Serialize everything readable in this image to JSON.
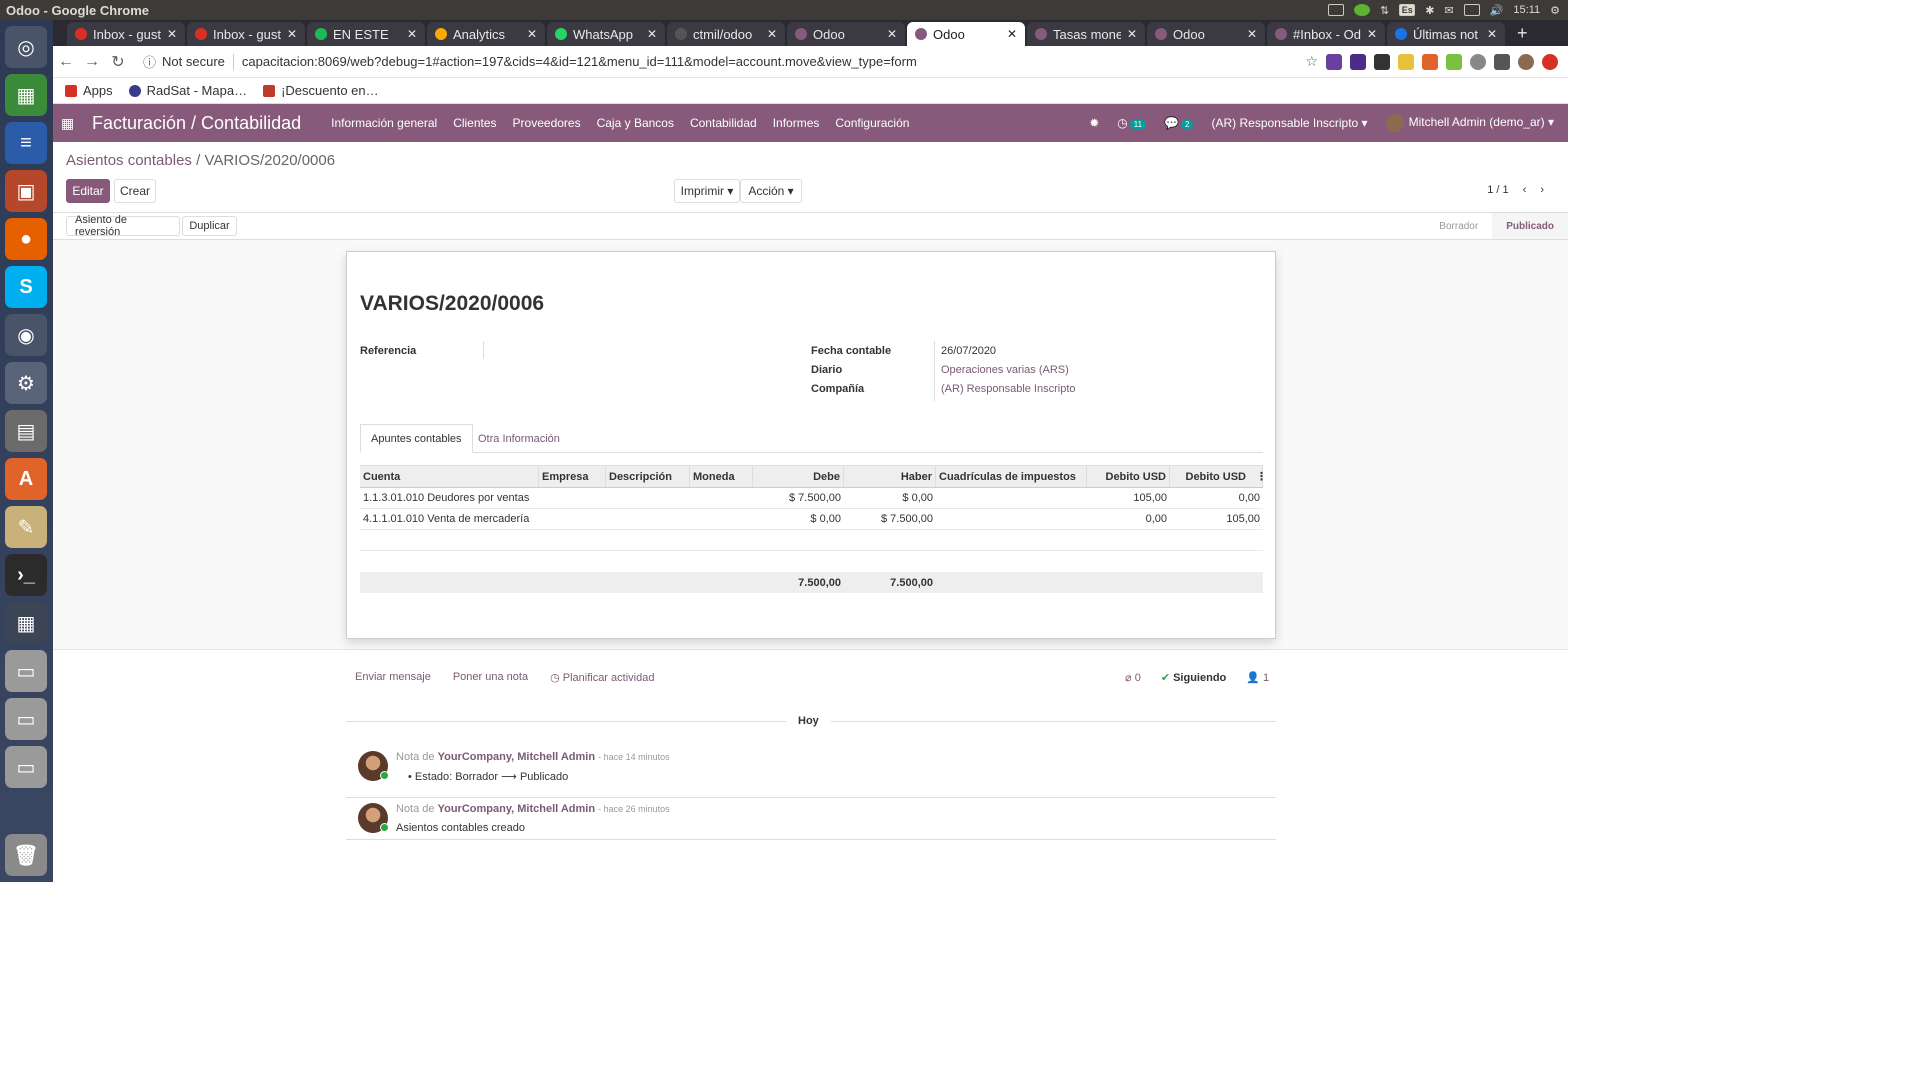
{
  "os": {
    "window_title": "Odoo - Google Chrome",
    "lang": "Es",
    "clock": "15:11"
  },
  "browser": {
    "tabs": [
      {
        "label": "Inbox - gust",
        "color": "#d93025",
        "active": false
      },
      {
        "label": "Inbox - gust",
        "color": "#d93025",
        "active": false
      },
      {
        "label": "EN ESTE",
        "color": "#1db954",
        "active": false
      },
      {
        "label": "Analytics",
        "color": "#f9ab00",
        "active": false
      },
      {
        "label": "WhatsApp",
        "color": "#25d366",
        "active": false
      },
      {
        "label": "ctmil/odoo",
        "color": "#555555",
        "active": false
      },
      {
        "label": "Odoo",
        "color": "#875a7b",
        "active": false
      },
      {
        "label": "Odoo",
        "color": "#875a7b",
        "active": true
      },
      {
        "label": "Tasas mone",
        "color": "#875a7b",
        "active": false
      },
      {
        "label": "Odoo",
        "color": "#875a7b",
        "active": false
      },
      {
        "label": "#Inbox - Od",
        "color": "#875a7b",
        "active": false
      },
      {
        "label": "Últimas not",
        "color": "#1a73e8",
        "active": false
      }
    ],
    "security": "Not secure",
    "url": "capacitacion:8069/web?debug=1#action=197&cids=4&id=121&menu_id=111&model=account.move&view_type=form",
    "bookmarks": [
      "Apps",
      "RadSat - Mapa…",
      "¡Descuento en…"
    ]
  },
  "odoo": {
    "app_title": "Facturación / Contabilidad",
    "menu": [
      "Información general",
      "Clientes",
      "Proveedores",
      "Caja y Bancos",
      "Contabilidad",
      "Informes",
      "Configuración"
    ],
    "activity_count": "11",
    "message_count": "2",
    "company": "(AR) Responsable Inscripto",
    "user": "Mitchell Admin (demo_ar)",
    "brand_color": "#875a7b"
  },
  "control": {
    "breadcrumb_parent": "Asientos contables",
    "breadcrumb_sep": "/",
    "breadcrumb_current": "VARIOS/2020/0006",
    "edit": "Editar",
    "create": "Crear",
    "print": "Imprimir",
    "action": "Acción",
    "pager": "1 / 1",
    "reverse": "Asiento de reversión",
    "duplicate": "Duplicar",
    "status_draft": "Borrador",
    "status_posted": "Publicado"
  },
  "form": {
    "title": "VARIOS/2020/0006",
    "ref_label": "Referencia",
    "ref_value": "",
    "date_label": "Fecha contable",
    "date_value": "26/07/2020",
    "journal_label": "Diario",
    "journal_value": "Operaciones varias (ARS)",
    "company_label": "Compañía",
    "company_value": "(AR) Responsable Inscripto",
    "tab_lines": "Apuntes contables",
    "tab_other": "Otra Información"
  },
  "table": {
    "headers": [
      "Cuenta",
      "Empresa",
      "Descripción",
      "Moneda",
      "Debe",
      "Haber",
      "Cuadrículas de impuestos",
      "Debito USD",
      "Debito USD"
    ],
    "rows": [
      [
        "1.1.3.01.010 Deudores por ventas",
        "",
        "",
        "",
        "$ 7.500,00",
        "$ 0,00",
        "",
        "105,00",
        "0,00"
      ],
      [
        "4.1.1.01.010 Venta de mercadería",
        "",
        "",
        "",
        "$ 0,00",
        "$ 7.500,00",
        "",
        "0,00",
        "105,00"
      ]
    ],
    "total_debit": "7.500,00",
    "total_credit": "7.500,00"
  },
  "chatter": {
    "send_message": "Enviar mensaje",
    "log_note": "Poner una nota",
    "schedule": "Planificar actividad",
    "attachments": "0",
    "following": "Siguiendo",
    "followers": "1",
    "day": "Hoy",
    "messages": [
      {
        "prefix": "Nota de",
        "author": "YourCompany, Mitchell Admin",
        "time": "- hace 14 minutos",
        "body": "Estado: Borrador ⟶ Publicado"
      },
      {
        "prefix": "Nota de",
        "author": "YourCompany, Mitchell Admin",
        "time": "- hace 26 minutos",
        "body": "Asientos contables creado"
      }
    ]
  }
}
